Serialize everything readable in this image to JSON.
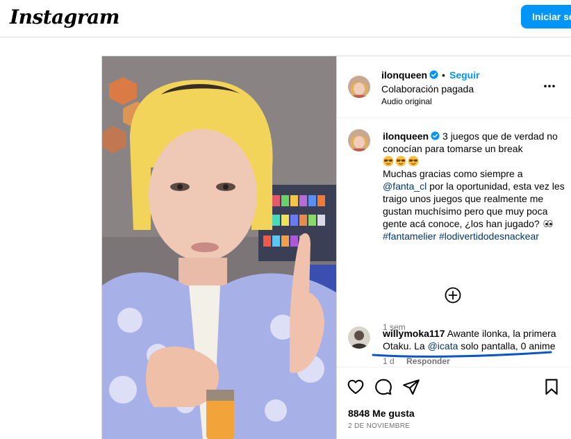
{
  "brand": {
    "logo_text": "Instagram"
  },
  "topbar": {
    "login_label": "Iniciar sesión"
  },
  "post": {
    "header": {
      "username": "ilonqueen",
      "separator": "•",
      "follow_label": "Seguir",
      "paid_label": "Colaboración pagada",
      "audio_label": "Audio original"
    },
    "caption": {
      "username": "ilonqueen",
      "line1": "3 juegos que de verdad no conocían para tomarse un break",
      "emoji_count": 3,
      "text_a": "Muchas gracias como siempre a",
      "mention": "@fanta_cl",
      "text_b": "por la oportunidad, esta vez les traigo unos juegos que realmente me gustan muchísimo pero que muy poca gente acá conoce, ¿los han jugado?",
      "hashtag1": "#fantamelier",
      "hashtag2": "#lodivertidodesnackear",
      "time": "1 sem"
    },
    "comment": {
      "username": "willymoka117",
      "text_a": "Awante ilonka, la primera Otaku. La",
      "mention": "@icata",
      "text_b": "solo pantalla, 0 anime",
      "time": "1 d",
      "reply_label": "Responder"
    },
    "likes": "8848 Me gusta",
    "date": "2 DE NOVIEMBRE"
  },
  "icons": [
    "verified-icon",
    "more-options-icon",
    "plus-circle-icon",
    "heart-icon",
    "comment-icon",
    "share-icon",
    "bookmark-icon"
  ],
  "colors": {
    "accent": "#0095f6",
    "link": "#00376b",
    "muted": "#737373",
    "annotation": "#0a55c4"
  }
}
